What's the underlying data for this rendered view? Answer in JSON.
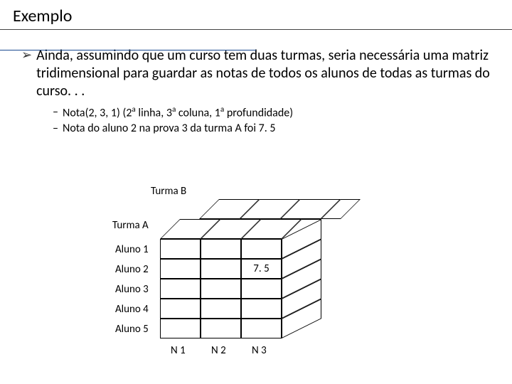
{
  "title": "Exemplo",
  "main_bullet": "Ainda, assumindo que um curso tem duas turmas, seria necessária uma matriz tridimensional para guardar as notas de todos os alunos de todas as turmas do curso. . .",
  "sub_bullets": [
    {
      "pre": "Nota(2, 3, 1) (2",
      "s1": "a",
      "mid1": " linha, 3",
      "s2": "a",
      "mid2": " coluna, 1",
      "s3": "a",
      "post": " profundidade)"
    },
    {
      "text": "Nota do aluno 2 na prova 3 da turma A foi 7. 5"
    }
  ],
  "diagram": {
    "turma_b": "Turma B",
    "turma_a": "Turma A",
    "row_labels": [
      "Aluno 1",
      "Aluno 2",
      "Aluno 3",
      "Aluno 4",
      "Aluno 5"
    ],
    "col_labels": [
      "N 1",
      "N 2",
      "N 3"
    ],
    "cell_value": "7. 5"
  }
}
